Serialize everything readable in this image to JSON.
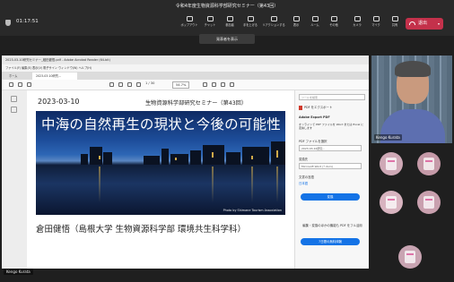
{
  "window": {
    "title": "令和4年度生物資源科学部研究セミナー（第43回）"
  },
  "meeting": {
    "timer": "01:17:51",
    "toolbar": [
      {
        "label": "ポップアウト",
        "icon": "popout-icon"
      },
      {
        "label": "チャット",
        "icon": "chat-icon"
      },
      {
        "label": "参加者",
        "icon": "people-icon"
      },
      {
        "label": "手を上げる",
        "icon": "raise-hand-icon"
      },
      {
        "label": "リアクションする",
        "icon": "reaction-icon"
      },
      {
        "label": "表示",
        "icon": "view-icon"
      },
      {
        "label": "ルーム",
        "icon": "rooms-icon"
      },
      {
        "label": "その他",
        "icon": "more-icon"
      },
      {
        "label": "カメラ",
        "icon": "camera-icon"
      },
      {
        "label": "マイク",
        "icon": "mic-icon"
      },
      {
        "label": "共有",
        "icon": "share-icon"
      }
    ],
    "leave_label": "退出",
    "accent": "#c4314b",
    "speaker_tooltip": "発表者を表示"
  },
  "acrobat": {
    "title": "2023-03-10研究セミナー_蔵田健悟.pdf - Adobe Acrobat Reader (64-bit)",
    "menu": "ファイル(F)  編集(E)  表示(V)  電子サイン  ウィンドウ(W)  ヘルプ(H)",
    "tabs": [
      "ホーム",
      "2023-03-10研究..."
    ],
    "page_indicator": "1 / 30",
    "zoom": "54.7%",
    "pane": {
      "search_placeholder": "ツールを検索",
      "export_header": "PDF をエクスポート",
      "export_title": "Adobe Export PDF",
      "export_desc": "オンラインで PDF ファイルを Word または Excel に変換します",
      "select_label": "PDF ファイルを選択",
      "selected_file": "2023-03-10研究...",
      "convert_label": "変換先",
      "format": "Microsoft Word (*.docx)",
      "language_label": "文書の言語",
      "language": "日本語",
      "convert_button": "変換",
      "promo": "編集・変換のほかの機能も PDF をフル活用",
      "trial_button": "7日間の無料体験"
    }
  },
  "slide": {
    "date": "2023-03-10",
    "seminar": "生物資源科学部研究セミナー（第43回）",
    "title": "中海の自然再生の現状と今後の可能性",
    "photo_credit": "Photo by Shimane Tourism Association",
    "author": "倉田健悟（島根大学 生物資源科学部 環境共生科学科）"
  },
  "participants": {
    "presenter_name": "Kengo Kurata",
    "self_label": "Kengo Kurata",
    "avatar_colors": [
      "#cfa9b6",
      "#c59aa8",
      "#d8b4c0",
      "#c9a0ae",
      "#c8a4b2",
      "#cfa9b6"
    ]
  }
}
